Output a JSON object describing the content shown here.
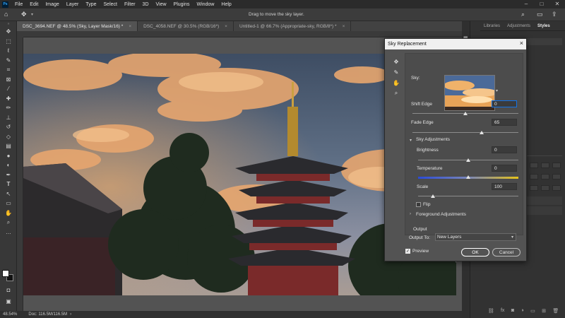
{
  "app": {
    "logo": "Ps",
    "menu": [
      "File",
      "Edit",
      "Image",
      "Layer",
      "Type",
      "Select",
      "Filter",
      "3D",
      "View",
      "Plugins",
      "Window",
      "Help"
    ],
    "window_controls": [
      "–",
      "□",
      "✕"
    ]
  },
  "options": {
    "hint": "Drag to move the sky layer."
  },
  "tabs": [
    {
      "label": "DSC_3694.NEF @ 48.5% (Sky, Layer Mask/16) *",
      "active": true
    },
    {
      "label": "DSC_4058.NEF @ 30.5% (RGB/16*)",
      "active": false
    },
    {
      "label": "Untitled-1 @ 66.7% (Appropriate-sky, RGB/8*) *",
      "active": false
    }
  ],
  "status": {
    "zoom": "48.54%",
    "doc": "Doc: 116.5M/116.5M"
  },
  "panels": {
    "tabs": [
      "Libraries",
      "Adjustments",
      "Styles"
    ],
    "active": "Styles"
  },
  "dialog": {
    "title": "Sky Replacement",
    "sky_label": "Sky:",
    "shift_edge": {
      "label": "Shift Edge",
      "value": "0",
      "frac": 0.5
    },
    "fade_edge": {
      "label": "Fade Edge",
      "value": "65",
      "frac": 0.65
    },
    "sky_adj": {
      "label": "Sky Adjustments"
    },
    "brightness": {
      "label": "Brightness",
      "value": "0",
      "frac": 0.5
    },
    "temperature": {
      "label": "Temperature",
      "value": "0",
      "frac": 0.5
    },
    "scale": {
      "label": "Scale",
      "value": "100",
      "frac": 0.15
    },
    "flip": {
      "label": "Flip"
    },
    "foreground_adj": {
      "label": "Foreground Adjustments"
    },
    "output": {
      "label": "Output",
      "output_to_label": "Output To:",
      "output_to_value": "New Layers"
    },
    "preview": {
      "label": "Preview"
    },
    "ok": "OK",
    "cancel": "Cancel"
  },
  "colors": {
    "accent": "#1473e6"
  }
}
